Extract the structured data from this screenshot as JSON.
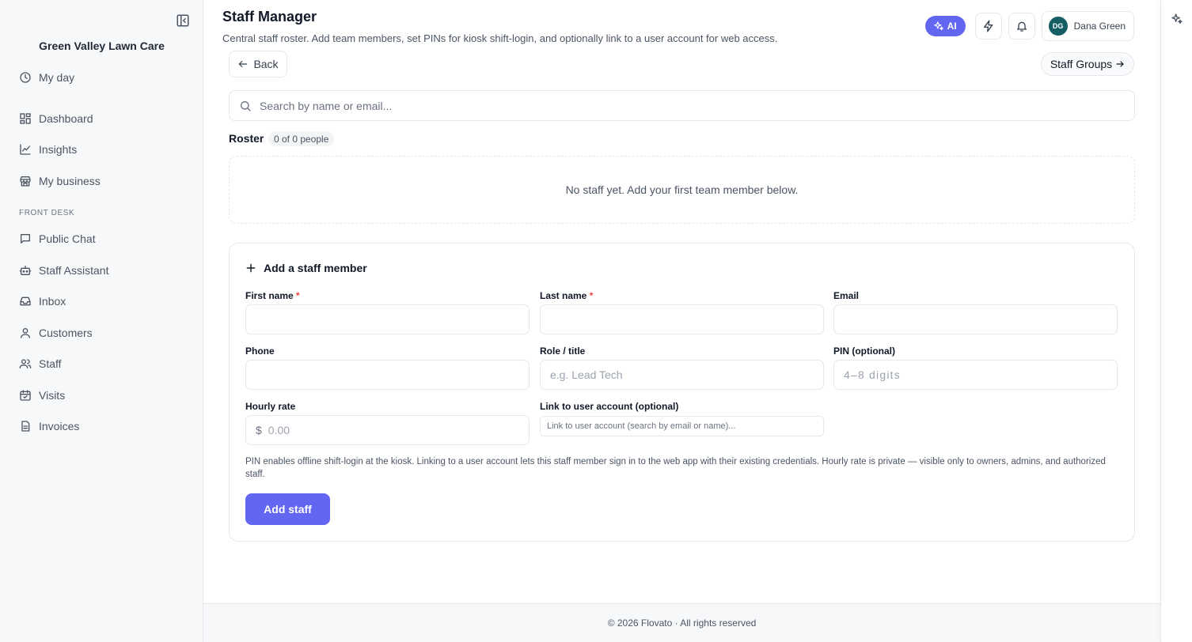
{
  "sidebar": {
    "business_name": "Green Valley Lawn Care",
    "section_front_desk": "FRONT DESK",
    "items": [
      {
        "label": "My day",
        "icon": "clock-icon"
      },
      {
        "label": "Dashboard",
        "icon": "dashboard-grid-icon"
      },
      {
        "label": "Insights",
        "icon": "line-chart-icon"
      },
      {
        "label": "My business",
        "icon": "store-icon"
      },
      {
        "label": "Public Chat",
        "icon": "chat-bubble-icon"
      },
      {
        "label": "Staff Assistant",
        "icon": "bot-icon"
      },
      {
        "label": "Inbox",
        "icon": "inbox-icon"
      },
      {
        "label": "Customers",
        "icon": "user-icon"
      },
      {
        "label": "Staff",
        "icon": "users-icon"
      },
      {
        "label": "Visits",
        "icon": "calendar-check-icon"
      },
      {
        "label": "Invoices",
        "icon": "document-icon"
      }
    ]
  },
  "header": {
    "title": "Staff Manager",
    "subtitle": "Central staff roster. Add team members, set PINs for kiosk shift-login, and optionally link to a user account for web access.",
    "ai_label": "AI",
    "user_initials": "DG",
    "user_name": "Dana Green"
  },
  "toolbar": {
    "back_label": "Back",
    "groups_label": "Staff Groups"
  },
  "search": {
    "placeholder": "Search by name or email..."
  },
  "roster": {
    "label": "Roster",
    "count": "0 of 0 people",
    "empty_message": "No staff yet. Add your first team member below."
  },
  "form": {
    "title": "Add a staff member",
    "first_name_label": "First name",
    "last_name_label": "Last name",
    "required_mark": "*",
    "email_label": "Email",
    "phone_label": "Phone",
    "role_label": "Role / title",
    "role_placeholder": "e.g. Lead Tech",
    "pin_label": "PIN (optional)",
    "pin_placeholder": "4–8 digits",
    "rate_label": "Hourly rate",
    "rate_prefix": "$",
    "rate_placeholder": "0.00",
    "link_label": "Link to user account (optional)",
    "link_placeholder": "Link to user account (search by email or name)...",
    "help_text": "PIN enables offline shift-login at the kiosk. Linking to a user account lets this staff member sign in to the web app with their existing credentials. Hourly rate is private — visible only to owners, admins, and authorized staff.",
    "submit_label": "Add staff"
  },
  "footer": {
    "text": "© 2026 Flovato · All rights reserved"
  },
  "colors": {
    "accent": "#6366f1",
    "avatar": "#155e63",
    "required": "#ef4444"
  }
}
